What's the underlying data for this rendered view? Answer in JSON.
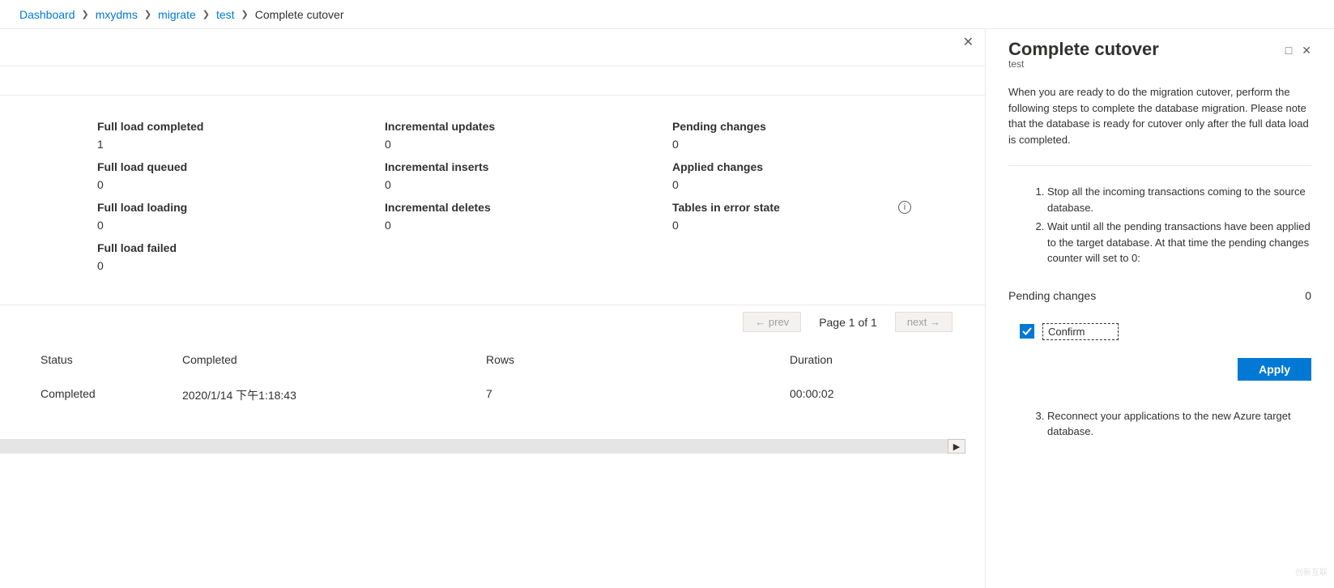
{
  "breadcrumb": {
    "items": [
      {
        "label": "Dashboard",
        "link": true
      },
      {
        "label": "mxydms",
        "link": true
      },
      {
        "label": "migrate",
        "link": true
      },
      {
        "label": "test",
        "link": true
      },
      {
        "label": "Complete cutover",
        "link": false
      }
    ]
  },
  "stats": {
    "full_load_completed": {
      "label": "Full load completed",
      "value": "1"
    },
    "incremental_updates": {
      "label": "Incremental updates",
      "value": "0"
    },
    "pending_changes": {
      "label": "Pending changes",
      "value": "0"
    },
    "full_load_queued": {
      "label": "Full load queued",
      "value": "0"
    },
    "incremental_inserts": {
      "label": "Incremental inserts",
      "value": "0"
    },
    "applied_changes": {
      "label": "Applied changes",
      "value": "0"
    },
    "full_load_loading": {
      "label": "Full load loading",
      "value": "0"
    },
    "incremental_deletes": {
      "label": "Incremental deletes",
      "value": "0"
    },
    "tables_error": {
      "label": "Tables in error state",
      "value": "0"
    },
    "full_load_failed": {
      "label": "Full load failed",
      "value": "0"
    }
  },
  "pagination": {
    "prev": "← prev",
    "info": "Page 1 of 1",
    "next": "next →"
  },
  "table": {
    "headers": {
      "status": "Status",
      "completed": "Completed",
      "rows": "Rows",
      "duration": "Duration"
    },
    "rows": [
      {
        "status": "Completed",
        "completed": "2020/1/14 下午1:18:43",
        "rows": "7",
        "duration": "00:00:02"
      }
    ]
  },
  "panel": {
    "title": "Complete cutover",
    "subtitle": "test",
    "description": "When you are ready to do the migration cutover, perform the following steps to complete the database migration. Please note that the database is ready for cutover only after the full data load is completed.",
    "steps": [
      "Stop all the incoming transactions coming to the source database.",
      "Wait until all the pending transactions have been applied to the target database. At that time the pending changes counter will set to 0:"
    ],
    "pending_label": "Pending changes",
    "pending_value": "0",
    "confirm_label": "Confirm",
    "apply_label": "Apply",
    "steps2": [
      "Reconnect your applications to the new Azure target database."
    ]
  },
  "watermark": "创新互联"
}
